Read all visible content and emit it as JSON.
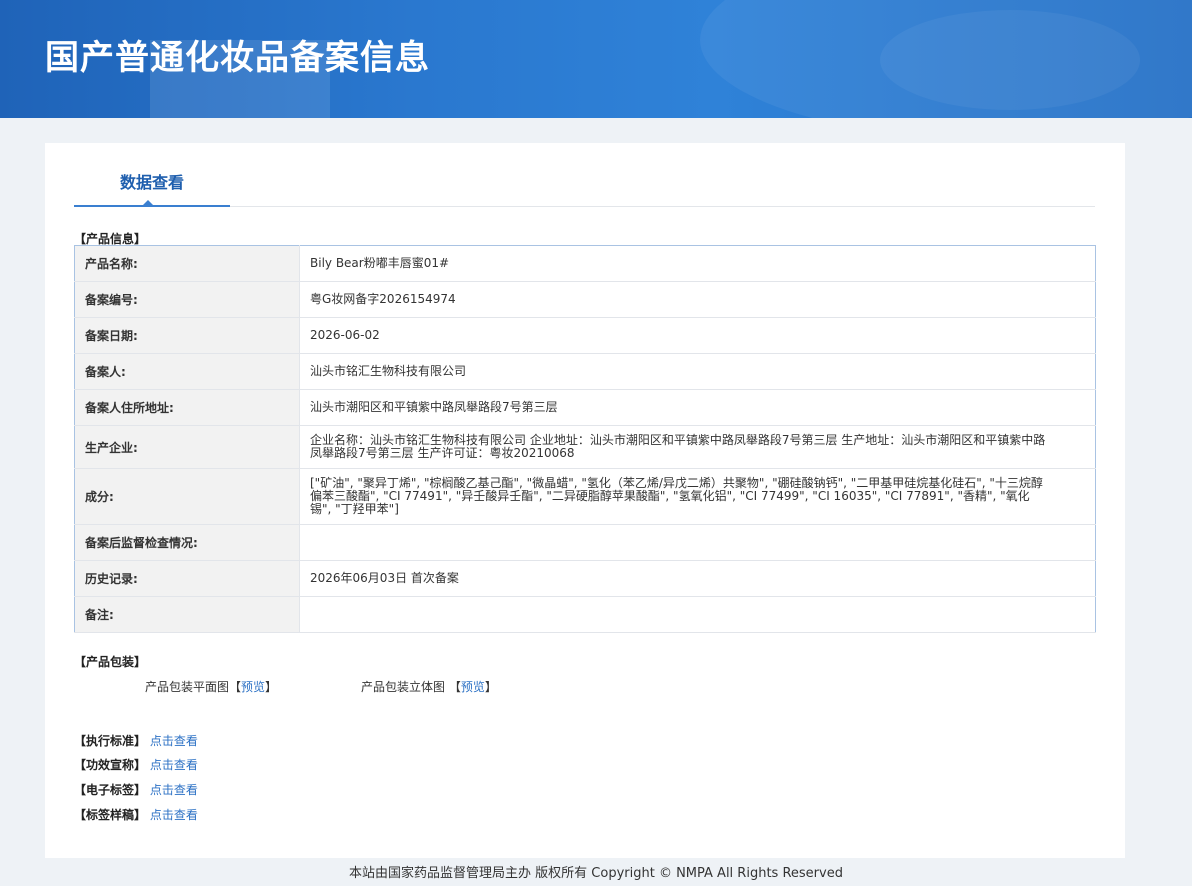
{
  "header": {
    "title": "国产普通化妆品备案信息"
  },
  "tabs": [
    {
      "label": "数据查看"
    }
  ],
  "product_info": {
    "section_title": "【产品信息】",
    "rows": [
      {
        "label": "产品名称:",
        "value": "Bily Bear粉嘟丰唇蜜01#"
      },
      {
        "label": "备案编号:",
        "value": "粤G妆网备字2026154974"
      },
      {
        "label": "备案日期:",
        "value": "2026-06-02"
      },
      {
        "label": "备案人:",
        "value": "汕头市铭汇生物科技有限公司"
      },
      {
        "label": "备案人住所地址:",
        "value": "汕头市潮阳区和平镇紫中路凤舉路段7号第三层"
      },
      {
        "label": "生产企业:",
        "value": "企业名称：汕头市铭汇生物科技有限公司 企业地址：汕头市潮阳区和平镇紫中路凤舉路段7号第三层 生产地址：汕头市潮阳区和平镇紫中路凤舉路段7号第三层 生产许可证：粤妆20210068"
      },
      {
        "label": "成分:",
        "value": "[\"矿油\", \"聚异丁烯\", \"棕榈酸乙基己酯\", \"微晶蜡\", \"氢化（苯乙烯/异戊二烯）共聚物\", \"硼硅酸钠钙\", \"二甲基甲硅烷基化硅石\", \"十三烷醇偏苯三酸酯\", \"CI 77491\", \"异壬酸异壬酯\", \"二异硬脂醇苹果酸酯\", \"氢氧化铝\", \"CI 77499\", \"CI 16035\", \"CI 77891\", \"香精\", \"氧化锡\", \"丁羟甲苯\"]"
      },
      {
        "label": "备案后监督检查情况:",
        "value": ""
      },
      {
        "label": "历史记录:",
        "value": "2026年06月03日 首次备案"
      },
      {
        "label": "备注:",
        "value": ""
      }
    ]
  },
  "packaging": {
    "section_title": "【产品包装】",
    "flat_label": "产品包装平面图",
    "solid_label": "产品包装立体图",
    "preview_link": "预览",
    "bracket_open": "【",
    "bracket_close": "】"
  },
  "standards": [
    {
      "label": "【执行标准】",
      "link": "点击查看"
    },
    {
      "label": "【功效宣称】",
      "link": "点击查看"
    },
    {
      "label": "【电子标签】",
      "link": "点击查看"
    },
    {
      "label": "【标签样稿】",
      "link": "点击查看"
    }
  ],
  "footer": {
    "text": "本站由国家药品监督管理局主办 版权所有 Copyright © NMPA All Rights Reserved"
  },
  "colors": {
    "banner": "#2a78cf",
    "link": "#2d72c5",
    "tab_accent": "#3a7fd0",
    "label_bg": "#f2f2f2"
  }
}
